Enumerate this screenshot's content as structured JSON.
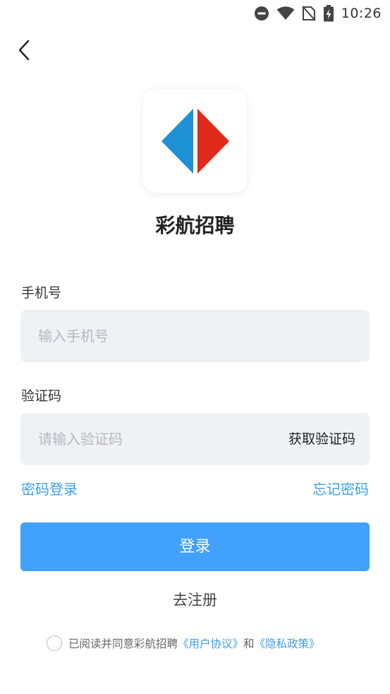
{
  "status_bar": {
    "time": "10:26",
    "icons": [
      "do-not-disturb-icon",
      "wifi-icon",
      "no-sim-icon",
      "battery-charging-icon"
    ]
  },
  "header": {
    "back_icon": "chevron-left-icon"
  },
  "app": {
    "name": "彩航招聘",
    "logo_colors": {
      "left": "#1e90d6",
      "right": "#e02a1d"
    }
  },
  "form": {
    "phone": {
      "label": "手机号",
      "placeholder": "输入手机号",
      "value": ""
    },
    "code": {
      "label": "验证码",
      "placeholder": "请输入验证码",
      "value": "",
      "get_code_label": "获取验证码"
    }
  },
  "links": {
    "password_login": "密码登录",
    "forgot_password": "忘记密码"
  },
  "actions": {
    "login_label": "登录",
    "register_label": "去注册"
  },
  "agreement": {
    "prefix": "已阅读并同意彩航招聘",
    "user_agreement": "《用户协议》",
    "and": "和",
    "privacy_policy": "《隐私政策》",
    "checked": false
  },
  "colors": {
    "accent": "#41a1fc",
    "link": "#3d9ee8",
    "input_bg": "#f0f1f5"
  }
}
